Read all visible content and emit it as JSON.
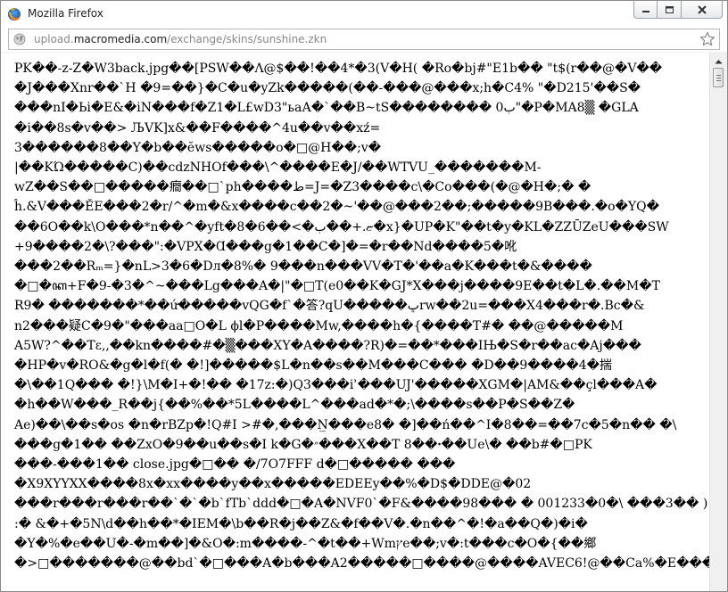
{
  "window": {
    "title": "Mozilla Firefox"
  },
  "url": {
    "prefix": "upload.",
    "domain": "macromedia.com",
    "path": "/exchange/skins/sunshine.zkn"
  },
  "colors": {
    "titlebar_bg": "#ffffff",
    "window_border": "#8a8a8a",
    "url_text": "#888888",
    "page_bg": "#ffffff"
  },
  "icons": {
    "app": "firefox-logo-icon",
    "page": "globe-icon",
    "bookmark": "star-icon"
  },
  "content": {
    "lines": [
      "PK��-z-Z�W3back.jpg��[PSW��Λ@$��!��4*�3(V�H( �Ro�bj#\"E1b�� \"t$(r��@�V��",
      "�J���Xnr��`H �9=��}�C�u�yZk�����(��-���@���x;h�C4% \"�D215'��S�",
      "���nI�Ьi�E&�iN���f�Z1�L£wD3\"ьаА�`��B~tS�������� ب0\"�P�MA8▒ �GLA",
      "�i��8s�v��> ЉVK]x&��F����^4u��v��xź=",
      "3������8��Y�b��ӗws�����o�□@H��;v�",
      "|��KΏ�����C)��cdzNHOf���\\^����E�J/��WTVU_�������M-",
      "wZ��S��□�����癎��□`ph����ط=J=�Z3����c\\�Co���(�@�H�;� �",
      "ĥ.&V���ĚE���2�r/^�m�&x����c��2�~'��@���2��;�����9B���.�o�YQ�",
      "��6O��k\\O���*n��^�yft�8�6��<�ޏ.+��ب�x}�UP�K\"��t�y�KL�ZZŪZeU���SW",
      "+9����2�\\?���\":�VPX�Ɑ���g�1��C�]�=�r��Nd����5�吪",
      "���2��Rₘ=}�nL>3�6�Dл�8%� 9���n���VV�T�'��a�K���t�&����",
      "�□�ꦏ+F�9-�3�^~���Lg���A�|\"�□T(e0��K�GJ*X���j����9E��t�L�.��M�T",
      "R9� �������*��ứ�����vQG�f`�答?qU�����ڀrw��2u=���X4���r�.Bc�&",
      "n2���疑C�9�\"���aa□O�L ϕl�P����Mw,����h�{����T#� ��@�����M",
      "A5W?^��Tɛ,,��kn����#�▒���XY�A����?R)�=��*���IЊ�S�r��ac�Aj���",
      "�HP�v�RO&�g�l�f(� �!]�����$L�n��s��M���C��� �D��9����4�揣",
      "�\\��1Q��� �!}\\M�I+�!�� �17z:�)Q3���iʾ���UJ'�����XGM�|AM&��çl���A�",
      "�h��W���_R��j{��%��*5L����L^���ad�*�;\\����s��P�S��Z�",
      "Ae)��\\��s�os �n�rBZp�!Q#I >#�,���N̲���e8� �]��ń��^I�8��=��7c�5�n�� �\\",
      "���g�1�� ��ZxO�9��u��s�I k�G�״���X��T 8��ꞏ��Ue\\� ��b#�□PK",
      "���-���1�� close.jpg�□�� �/7O7FFF d�□����� ���",
      "�X9XYYXX����8x�xx����y��x�����EDEEy��%�D$�DDE@�02",
      "���r���r���r��`�`�b`fTb`ddd�□�A�NVF0`�F&����98��� � 001233�0�\\ ���3�� )",
      ":� &�+�5N\\d��h��*�IEM�\\b��R�j��Z&�f��V�.�n��^�!�a��Q�)�i�",
      "�Y�%�e��U�-�m��]�&O�:m����-^�t��+Wmץe��;v�:t���c�O�{��鄉",
      "�>□�������@��bd`�□���A�b���A2�����□����@����AVEC6!@��Ca%�E���7�T6�"
    ]
  }
}
